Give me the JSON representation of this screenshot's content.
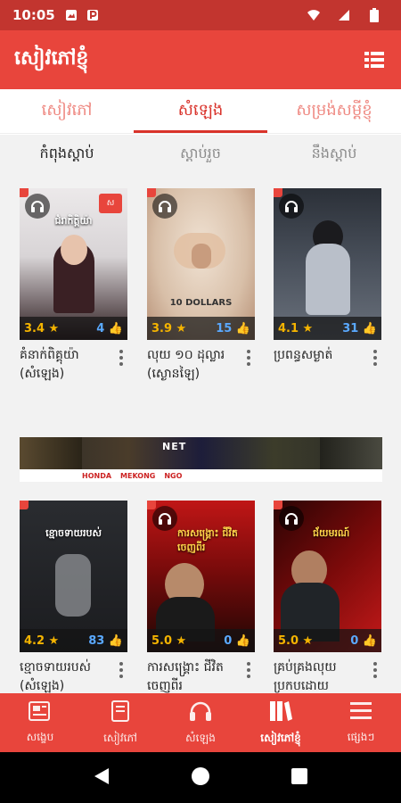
{
  "status": {
    "time": "10:05"
  },
  "appbar": {
    "title": "សៀវភៅខ្ញុំ"
  },
  "tabs": [
    {
      "label": "សៀវភៅ",
      "active": false
    },
    {
      "label": "សំឡេង",
      "active": true
    },
    {
      "label": "សម្រង់សម្ដីខ្ញុំ",
      "active": false
    }
  ],
  "subtabs": [
    {
      "label": "កំពុងស្ដាប់",
      "active": true
    },
    {
      "label": "ស្ដាប់រួច",
      "active": false
    },
    {
      "label": "នឹងស្ដាប់",
      "active": false
    }
  ],
  "row1": [
    {
      "title": "គំនាក់ពិគ្គុយ៉ា (សំឡេង)",
      "rating": "3.4 ★",
      "likes": "4 👍",
      "cover_text": "ជំរាកិត្តិយ៉ា",
      "logo": "ស",
      "subtitle": "",
      "colors": [
        "#e9e6e8",
        "#3a2024"
      ]
    },
    {
      "title": "លុយ ១០ ដុល្លារ (ស្ងោ​ន​ឡៃ)",
      "rating": "3.9 ★",
      "likes": "15 👍",
      "cover_text": "",
      "logo": "",
      "subtitle": "10 DOLLARS",
      "colors": [
        "#e9d9c8",
        "#caa58a"
      ]
    },
    {
      "title": "ប្រពន្ធសម្ងាត់",
      "rating": "4.1 ★",
      "likes": "31 👍",
      "cover_text": "",
      "logo": "",
      "subtitle": "",
      "colors": [
        "#3e4550",
        "#9aa0aa"
      ]
    }
  ],
  "row2": [
    {
      "title": "ខ្មោចទាយរបស់ (សំឡេង)",
      "rating": "4.2 ★",
      "likes": "83 👍",
      "cover_text": "ខ្មោចទាយរបស់",
      "logo": "",
      "subtitle": "",
      "colors": [
        "#1d1f22",
        "#6d6f73"
      ]
    },
    {
      "title": "ការសង្គ្រោះ ជីវិតចេញពីរ",
      "rating": "5.0 ★",
      "likes": "0 👍",
      "cover_text": "ការសង្គ្រោះ ជីវិតចេញពីរ",
      "logo": "",
      "subtitle": "",
      "colors": [
        "#b51212",
        "#2a0a08"
      ]
    },
    {
      "title": "គ្រប់គ្រងលុយ ប្រកបដោយ",
      "rating": "5.0 ★",
      "likes": "0 👍",
      "cover_text": "ជ័យមរណ៍",
      "logo": "",
      "subtitle": "",
      "colors": [
        "#3a0606",
        "#c11818"
      ]
    }
  ],
  "banner": {
    "brand": "NET",
    "sponsors": [
      "HONDA",
      "MEKONG",
      "NGO"
    ]
  },
  "bottom_nav": [
    {
      "label": "សង្ខេប",
      "icon": "newspaper-icon",
      "active": false
    },
    {
      "label": "សៀវភៅ",
      "icon": "book-icon",
      "active": false
    },
    {
      "label": "សំឡេង",
      "icon": "headphones-icon",
      "active": false
    },
    {
      "label": "សៀវភៅខ្ញុំ",
      "icon": "library-icon",
      "active": true
    },
    {
      "label": "ផ្សេងៗ",
      "icon": "menu-icon",
      "active": false
    }
  ]
}
